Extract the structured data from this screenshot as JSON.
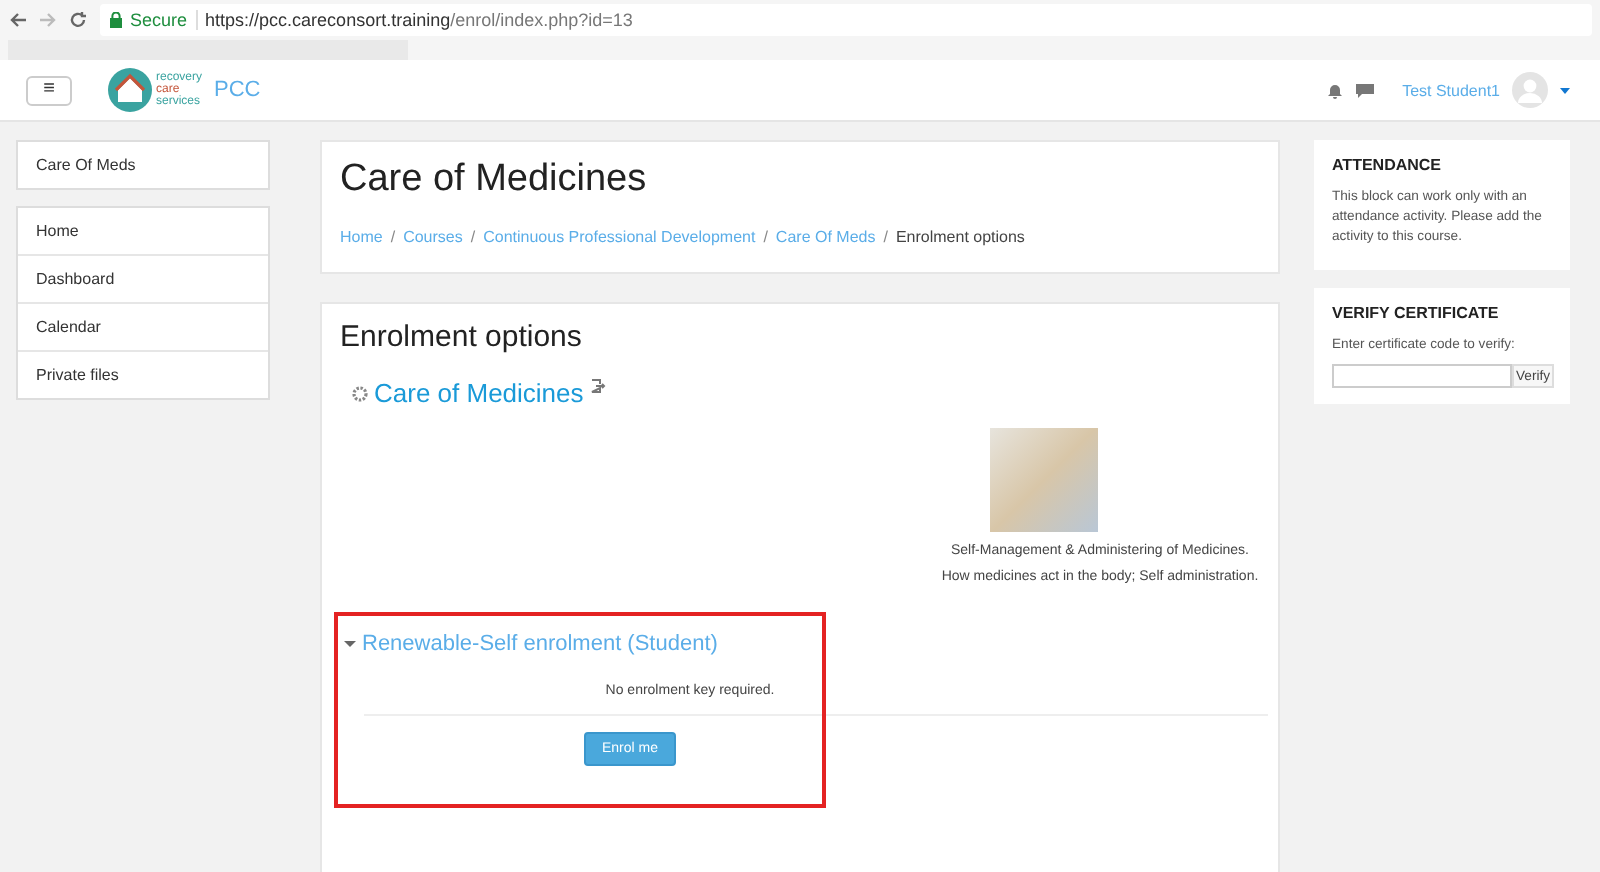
{
  "browser": {
    "secure_label": "Secure",
    "url_host": "https://pcc.careconsort.training",
    "url_path": "/enrol/index.php?id=13"
  },
  "navbar": {
    "menu_glyph": "≡",
    "logo_lines": [
      "recovery",
      "care",
      "services"
    ],
    "site_name": "PCC",
    "user_name": "Test Student1"
  },
  "sidebar": {
    "course": "Care Of Meds",
    "items": [
      {
        "label": "Home"
      },
      {
        "label": "Dashboard"
      },
      {
        "label": "Calendar"
      },
      {
        "label": "Private files"
      }
    ]
  },
  "header": {
    "title": "Care of Medicines",
    "breadcrumb": [
      {
        "label": "Home",
        "link": true
      },
      {
        "separator": "/",
        "label": "Courses",
        "link": true
      },
      {
        "separator": "/",
        "label": "Continuous Professional Development",
        "link": true
      },
      {
        "separator": "/",
        "label": "Care Of Meds",
        "link": true
      },
      {
        "separator": "/",
        "label": "Enrolment options",
        "link": false
      }
    ]
  },
  "enrolment": {
    "heading": "Enrolment options",
    "course_name": "Care of Medicines",
    "summary": [
      "Self-Management & Administering of Medicines.",
      "How medicines act in the body; Self administration."
    ],
    "method": {
      "title": "Renewable-Self enrolment (Student)",
      "expanded": true,
      "note": "No enrolment key required.",
      "button": "Enrol me"
    }
  },
  "blocks": {
    "attendance": {
      "title": "ATTENDANCE",
      "text": "This block can work only with an attendance activity. Please add the activity to this course."
    },
    "verify": {
      "title": "VERIFY CERTIFICATE",
      "label": "Enter certificate code to verify:",
      "button": "Verify"
    }
  }
}
